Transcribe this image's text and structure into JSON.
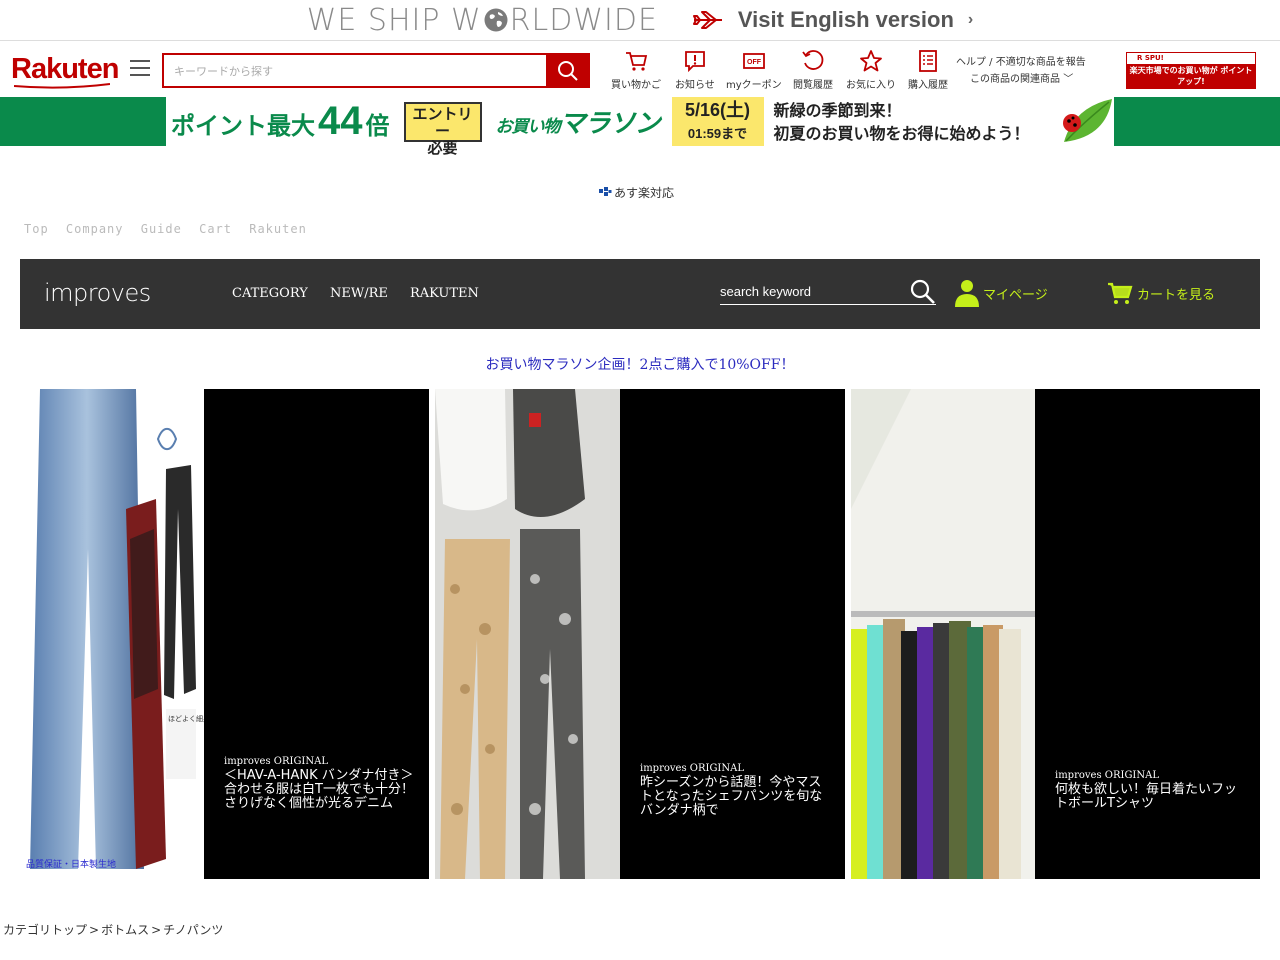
{
  "banner": {
    "ship_prefix": "WE SHIP W",
    "ship_suffix": "RLDWIDE",
    "visit_label": "Visit English version",
    "visit_chevron": "›"
  },
  "header": {
    "logo": "Rakuten",
    "search_placeholder": "キーワードから探す",
    "nav": [
      {
        "icon": "cart-icon",
        "label": "買い物かご"
      },
      {
        "icon": "notification-icon",
        "label": "お知らせ"
      },
      {
        "icon": "coupon-icon",
        "label": "myクーポン"
      },
      {
        "icon": "history-icon",
        "label": "閲覧履歴"
      },
      {
        "icon": "star-icon",
        "label": "お気に入り"
      },
      {
        "icon": "receipt-icon",
        "label": "購入履歴"
      }
    ],
    "coupon_icon_text": "OFF",
    "help_line1": "ヘルプ / 不適切な商品を報告",
    "help_line2": "この商品の関連商品",
    "help_chevron": "﹀",
    "spu_top": "R SPU!",
    "spu_main": "楽天市場でのお買い物が ポイントアップ!"
  },
  "campaign": {
    "point_prefix": "ポイント最大",
    "point_value": "44",
    "point_suffix": "倍",
    "entry_line1": "エントリー",
    "entry_line2": "必要",
    "marathon_prefix": "お買い物",
    "marathon_main": "マラソン",
    "date_line1": "5/16(土)",
    "date_line2": "01:59まで",
    "msg_line1": "新緑の季節到来！",
    "msg_line2": "初夏のお買い物をお得に始めよう！"
  },
  "asuraku": "あす楽対応",
  "toplinks": [
    "Top",
    "Company",
    "Guide",
    "Cart",
    "Rakuten"
  ],
  "shopnav": {
    "logo": "improves",
    "links": [
      "CATEGORY",
      "NEW/RE",
      "RAKUTEN"
    ],
    "search_placeholder": "search keyword",
    "mypage": "マイページ",
    "cart": "カートを見る"
  },
  "promo": "お買い物マラソン企画！2点ご購入で10%OFF！",
  "cards": [
    {
      "tag": "improves ORIGINAL",
      "desc": "＜HAV-A-HANK バンダナ付き＞合わせる服は白T一枚でも十分！さりげなく個性が光るデニム"
    },
    {
      "tag": "improves ORIGINAL",
      "desc": "昨シーズンから話題！今やマストとなったシェフパンツを旬なバンダナ柄で"
    },
    {
      "tag": "improves ORIGINAL",
      "desc": "何枚も欲しい！毎日着たいフットボールTシャツ"
    }
  ],
  "card1_side_text": "ほどよく細身のテーパード",
  "card1_bottom_text": "品質保証・日本製生地",
  "breadcrumb": [
    "カテゴリトップ",
    ">",
    "ボトムス",
    ">",
    "チノパンツ"
  ],
  "colors": {
    "rakuten_red": "#bf0000",
    "campaign_green": "#0a8a4b",
    "campaign_yellow": "#fbe76c",
    "shopnav_bg": "#333333",
    "accent_lime": "#c5ef1a",
    "promo_blue": "#2b2bbf"
  }
}
